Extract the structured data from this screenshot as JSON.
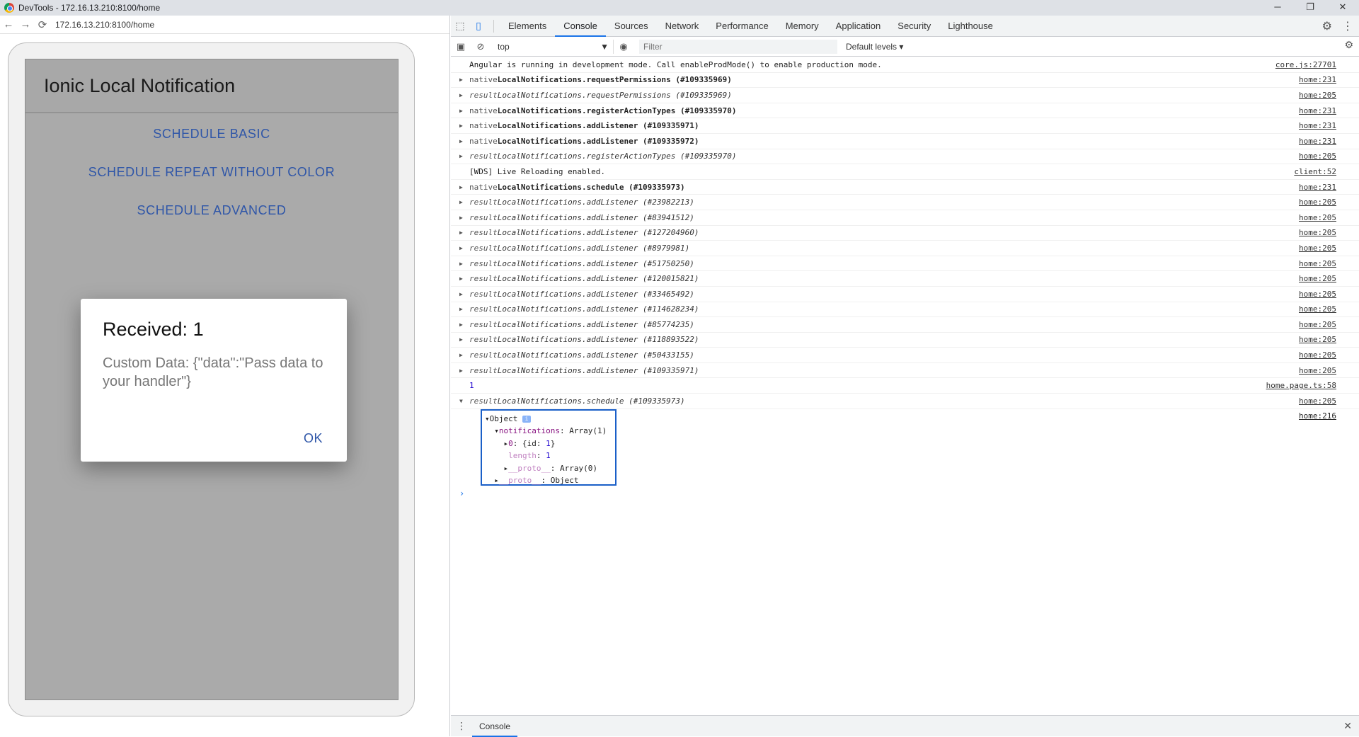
{
  "window": {
    "title": "DevTools - 172.16.13.210:8100/home",
    "controls": {
      "minimize": "─",
      "restore": "❐",
      "close": "✕"
    }
  },
  "browser": {
    "url": "172.16.13.210:8100/home",
    "nav": {
      "back": "←",
      "forward": "→",
      "reload": "⟳"
    }
  },
  "app": {
    "title": "Ionic Local Notification",
    "buttons": [
      "SCHEDULE BASIC",
      "SCHEDULE REPEAT WITHOUT COLOR",
      "SCHEDULE ADVANCED"
    ],
    "dialog": {
      "title": "Received: 1",
      "message": "Custom Data: {\"data\":\"Pass data to your handler\"}",
      "ok": "OK"
    }
  },
  "devtools": {
    "tabs": [
      "Elements",
      "Console",
      "Sources",
      "Network",
      "Performance",
      "Memory",
      "Application",
      "Security",
      "Lighthouse"
    ],
    "active_tab": "Console",
    "context": "top",
    "filter_placeholder": "Filter",
    "levels": "Default levels ▾",
    "drawer_tab": "Console",
    "console": [
      {
        "arrow": "",
        "kind": "",
        "text": "Angular is running in development mode. Call enableProdMode() to enable production mode.",
        "style": "plain",
        "src": "core.js:27701"
      },
      {
        "arrow": "▶",
        "kind": "native",
        "text": "LocalNotifications.requestPermissions (#109335969)",
        "style": "bold",
        "src": "home:231"
      },
      {
        "arrow": "▶",
        "kind": "result",
        "text": "LocalNotifications.requestPermissions (#109335969)",
        "style": "italic",
        "src": "home:205"
      },
      {
        "arrow": "▶",
        "kind": "native",
        "text": "LocalNotifications.registerActionTypes (#109335970)",
        "style": "bold",
        "src": "home:231"
      },
      {
        "arrow": "▶",
        "kind": "native",
        "text": "LocalNotifications.addListener (#109335971)",
        "style": "bold",
        "src": "home:231"
      },
      {
        "arrow": "▶",
        "kind": "native",
        "text": "LocalNotifications.addListener (#109335972)",
        "style": "bold",
        "src": "home:231"
      },
      {
        "arrow": "▶",
        "kind": "result",
        "text": "LocalNotifications.registerActionTypes (#109335970)",
        "style": "italic",
        "src": "home:205"
      },
      {
        "arrow": "",
        "kind": "",
        "text": "[WDS] Live Reloading enabled.",
        "style": "plain",
        "src": "client:52"
      },
      {
        "arrow": "▶",
        "kind": "native",
        "text": "LocalNotifications.schedule (#109335973)",
        "style": "bold",
        "src": "home:231"
      },
      {
        "arrow": "▶",
        "kind": "result",
        "text": "LocalNotifications.addListener (#23982213)",
        "style": "italic",
        "src": "home:205"
      },
      {
        "arrow": "▶",
        "kind": "result",
        "text": "LocalNotifications.addListener (#83941512)",
        "style": "italic",
        "src": "home:205"
      },
      {
        "arrow": "▶",
        "kind": "result",
        "text": "LocalNotifications.addListener (#127204960)",
        "style": "italic",
        "src": "home:205"
      },
      {
        "arrow": "▶",
        "kind": "result",
        "text": "LocalNotifications.addListener (#8979981)",
        "style": "italic",
        "src": "home:205"
      },
      {
        "arrow": "▶",
        "kind": "result",
        "text": "LocalNotifications.addListener (#51750250)",
        "style": "italic",
        "src": "home:205"
      },
      {
        "arrow": "▶",
        "kind": "result",
        "text": "LocalNotifications.addListener (#120015821)",
        "style": "italic",
        "src": "home:205"
      },
      {
        "arrow": "▶",
        "kind": "result",
        "text": "LocalNotifications.addListener (#33465492)",
        "style": "italic",
        "src": "home:205"
      },
      {
        "arrow": "▶",
        "kind": "result",
        "text": "LocalNotifications.addListener (#114628234)",
        "style": "italic",
        "src": "home:205"
      },
      {
        "arrow": "▶",
        "kind": "result",
        "text": "LocalNotifications.addListener (#85774235)",
        "style": "italic",
        "src": "home:205"
      },
      {
        "arrow": "▶",
        "kind": "result",
        "text": "LocalNotifications.addListener (#118893522)",
        "style": "italic",
        "src": "home:205"
      },
      {
        "arrow": "▶",
        "kind": "result",
        "text": "LocalNotifications.addListener (#50433155)",
        "style": "italic",
        "src": "home:205"
      },
      {
        "arrow": "▶",
        "kind": "result",
        "text": "LocalNotifications.addListener (#109335971)",
        "style": "italic",
        "src": "home:205"
      },
      {
        "arrow": "",
        "kind": "",
        "text": "1",
        "style": "number",
        "src": "home.page.ts:58"
      },
      {
        "arrow": "▼",
        "kind": "result",
        "text": "LocalNotifications.schedule (#109335973)",
        "style": "italic",
        "src": "home:205"
      }
    ],
    "object_tree": {
      "src": "home:216",
      "root": "Object",
      "info": "i",
      "notifications_key": "notifications",
      "notifications_val": "Array(1)",
      "item_key": "0",
      "item_val_prefix": "{id: ",
      "item_val_num": "1",
      "item_val_suffix": "}",
      "length_key": "length",
      "length_val": "1",
      "proto_key": "__proto__",
      "proto_arr_val": "Array(0)",
      "proto_obj_val": "Object"
    },
    "prompt": "›"
  }
}
